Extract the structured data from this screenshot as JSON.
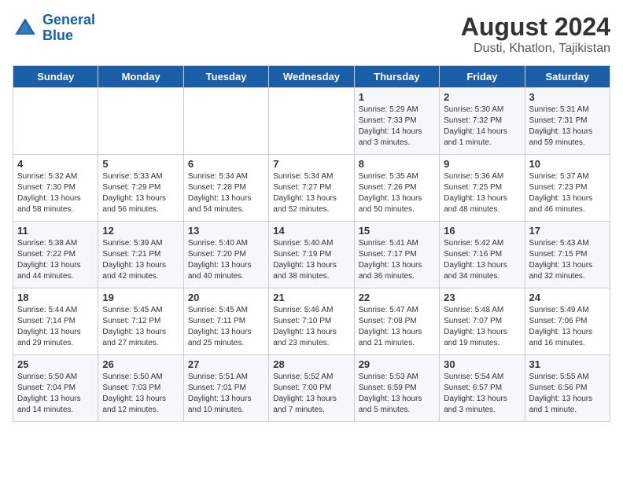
{
  "logo": {
    "line1": "General",
    "line2": "Blue"
  },
  "title": "August 2024",
  "subtitle": "Dusti, Khatlon, Tajikistan",
  "days_of_week": [
    "Sunday",
    "Monday",
    "Tuesday",
    "Wednesday",
    "Thursday",
    "Friday",
    "Saturday"
  ],
  "weeks": [
    [
      {
        "day": "",
        "sunrise": "",
        "sunset": "",
        "daylight": ""
      },
      {
        "day": "",
        "sunrise": "",
        "sunset": "",
        "daylight": ""
      },
      {
        "day": "",
        "sunrise": "",
        "sunset": "",
        "daylight": ""
      },
      {
        "day": "",
        "sunrise": "",
        "sunset": "",
        "daylight": ""
      },
      {
        "day": "1",
        "sunrise": "Sunrise: 5:29 AM",
        "sunset": "Sunset: 7:33 PM",
        "daylight": "Daylight: 14 hours and 3 minutes."
      },
      {
        "day": "2",
        "sunrise": "Sunrise: 5:30 AM",
        "sunset": "Sunset: 7:32 PM",
        "daylight": "Daylight: 14 hours and 1 minute."
      },
      {
        "day": "3",
        "sunrise": "Sunrise: 5:31 AM",
        "sunset": "Sunset: 7:31 PM",
        "daylight": "Daylight: 13 hours and 59 minutes."
      }
    ],
    [
      {
        "day": "4",
        "sunrise": "Sunrise: 5:32 AM",
        "sunset": "Sunset: 7:30 PM",
        "daylight": "Daylight: 13 hours and 58 minutes."
      },
      {
        "day": "5",
        "sunrise": "Sunrise: 5:33 AM",
        "sunset": "Sunset: 7:29 PM",
        "daylight": "Daylight: 13 hours and 56 minutes."
      },
      {
        "day": "6",
        "sunrise": "Sunrise: 5:34 AM",
        "sunset": "Sunset: 7:28 PM",
        "daylight": "Daylight: 13 hours and 54 minutes."
      },
      {
        "day": "7",
        "sunrise": "Sunrise: 5:34 AM",
        "sunset": "Sunset: 7:27 PM",
        "daylight": "Daylight: 13 hours and 52 minutes."
      },
      {
        "day": "8",
        "sunrise": "Sunrise: 5:35 AM",
        "sunset": "Sunset: 7:26 PM",
        "daylight": "Daylight: 13 hours and 50 minutes."
      },
      {
        "day": "9",
        "sunrise": "Sunrise: 5:36 AM",
        "sunset": "Sunset: 7:25 PM",
        "daylight": "Daylight: 13 hours and 48 minutes."
      },
      {
        "day": "10",
        "sunrise": "Sunrise: 5:37 AM",
        "sunset": "Sunset: 7:23 PM",
        "daylight": "Daylight: 13 hours and 46 minutes."
      }
    ],
    [
      {
        "day": "11",
        "sunrise": "Sunrise: 5:38 AM",
        "sunset": "Sunset: 7:22 PM",
        "daylight": "Daylight: 13 hours and 44 minutes."
      },
      {
        "day": "12",
        "sunrise": "Sunrise: 5:39 AM",
        "sunset": "Sunset: 7:21 PM",
        "daylight": "Daylight: 13 hours and 42 minutes."
      },
      {
        "day": "13",
        "sunrise": "Sunrise: 5:40 AM",
        "sunset": "Sunset: 7:20 PM",
        "daylight": "Daylight: 13 hours and 40 minutes."
      },
      {
        "day": "14",
        "sunrise": "Sunrise: 5:40 AM",
        "sunset": "Sunset: 7:19 PM",
        "daylight": "Daylight: 13 hours and 38 minutes."
      },
      {
        "day": "15",
        "sunrise": "Sunrise: 5:41 AM",
        "sunset": "Sunset: 7:17 PM",
        "daylight": "Daylight: 13 hours and 36 minutes."
      },
      {
        "day": "16",
        "sunrise": "Sunrise: 5:42 AM",
        "sunset": "Sunset: 7:16 PM",
        "daylight": "Daylight: 13 hours and 34 minutes."
      },
      {
        "day": "17",
        "sunrise": "Sunrise: 5:43 AM",
        "sunset": "Sunset: 7:15 PM",
        "daylight": "Daylight: 13 hours and 32 minutes."
      }
    ],
    [
      {
        "day": "18",
        "sunrise": "Sunrise: 5:44 AM",
        "sunset": "Sunset: 7:14 PM",
        "daylight": "Daylight: 13 hours and 29 minutes."
      },
      {
        "day": "19",
        "sunrise": "Sunrise: 5:45 AM",
        "sunset": "Sunset: 7:12 PM",
        "daylight": "Daylight: 13 hours and 27 minutes."
      },
      {
        "day": "20",
        "sunrise": "Sunrise: 5:45 AM",
        "sunset": "Sunset: 7:11 PM",
        "daylight": "Daylight: 13 hours and 25 minutes."
      },
      {
        "day": "21",
        "sunrise": "Sunrise: 5:46 AM",
        "sunset": "Sunset: 7:10 PM",
        "daylight": "Daylight: 13 hours and 23 minutes."
      },
      {
        "day": "22",
        "sunrise": "Sunrise: 5:47 AM",
        "sunset": "Sunset: 7:08 PM",
        "daylight": "Daylight: 13 hours and 21 minutes."
      },
      {
        "day": "23",
        "sunrise": "Sunrise: 5:48 AM",
        "sunset": "Sunset: 7:07 PM",
        "daylight": "Daylight: 13 hours and 19 minutes."
      },
      {
        "day": "24",
        "sunrise": "Sunrise: 5:49 AM",
        "sunset": "Sunset: 7:06 PM",
        "daylight": "Daylight: 13 hours and 16 minutes."
      }
    ],
    [
      {
        "day": "25",
        "sunrise": "Sunrise: 5:50 AM",
        "sunset": "Sunset: 7:04 PM",
        "daylight": "Daylight: 13 hours and 14 minutes."
      },
      {
        "day": "26",
        "sunrise": "Sunrise: 5:50 AM",
        "sunset": "Sunset: 7:03 PM",
        "daylight": "Daylight: 13 hours and 12 minutes."
      },
      {
        "day": "27",
        "sunrise": "Sunrise: 5:51 AM",
        "sunset": "Sunset: 7:01 PM",
        "daylight": "Daylight: 13 hours and 10 minutes."
      },
      {
        "day": "28",
        "sunrise": "Sunrise: 5:52 AM",
        "sunset": "Sunset: 7:00 PM",
        "daylight": "Daylight: 13 hours and 7 minutes."
      },
      {
        "day": "29",
        "sunrise": "Sunrise: 5:53 AM",
        "sunset": "Sunset: 6:59 PM",
        "daylight": "Daylight: 13 hours and 5 minutes."
      },
      {
        "day": "30",
        "sunrise": "Sunrise: 5:54 AM",
        "sunset": "Sunset: 6:57 PM",
        "daylight": "Daylight: 13 hours and 3 minutes."
      },
      {
        "day": "31",
        "sunrise": "Sunrise: 5:55 AM",
        "sunset": "Sunset: 6:56 PM",
        "daylight": "Daylight: 13 hours and 1 minute."
      }
    ]
  ]
}
